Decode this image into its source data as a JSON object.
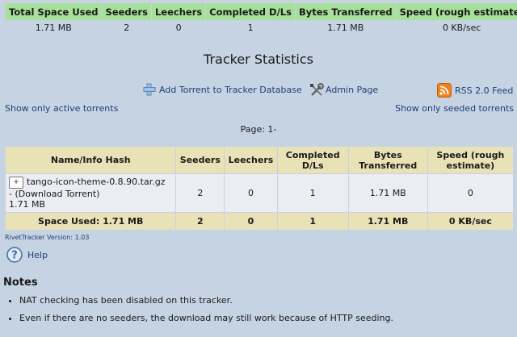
{
  "summary": {
    "headers": [
      "Total Space Used",
      "Seeders",
      "Leechers",
      "Completed D/Ls",
      "Bytes Transferred",
      "Speed (rough estimate)"
    ],
    "values": [
      "1.71 MB",
      "2",
      "0",
      "1",
      "1.71 MB",
      "0 KB/sec"
    ]
  },
  "page_title": "Tracker Statistics",
  "toolbar": {
    "add_torrent": "Add Torrent to Tracker Database",
    "admin": "Admin Page",
    "rss": "RSS 2.0 Feed"
  },
  "filters": {
    "active": "Show only active torrents",
    "seeded": "Show only seeded torrents"
  },
  "pager": "Page: 1-",
  "table": {
    "headers": [
      "Name/Info Hash",
      "Seeders",
      "Leechers",
      "Completed D/Ls",
      "Bytes Transferred",
      "Speed (rough estimate)"
    ],
    "row": {
      "expand": "+",
      "name": "tango-icon-theme-0.8.90.tar.gz",
      "download": "- (Download Torrent)",
      "size": "1.71 MB",
      "seeders": "2",
      "leechers": "0",
      "completed": "1",
      "bytes": "1.71 MB",
      "speed": "0"
    },
    "total": {
      "label": "Space Used: 1.71 MB",
      "seeders": "2",
      "leechers": "0",
      "completed": "1",
      "bytes": "1.71 MB",
      "speed": "0 KB/sec"
    }
  },
  "version": "RivetTracker Version: 1.03",
  "help": "Help",
  "notes": {
    "heading": "Notes",
    "items": [
      "NAT checking has been disabled on this tracker.",
      "Even if there are no seeders, the download may still work because of HTTP seeding."
    ]
  },
  "icons": {
    "add": "add-torrent-icon",
    "admin": "admin-tools-icon",
    "rss": "rss-feed-icon",
    "help": "help-icon"
  }
}
